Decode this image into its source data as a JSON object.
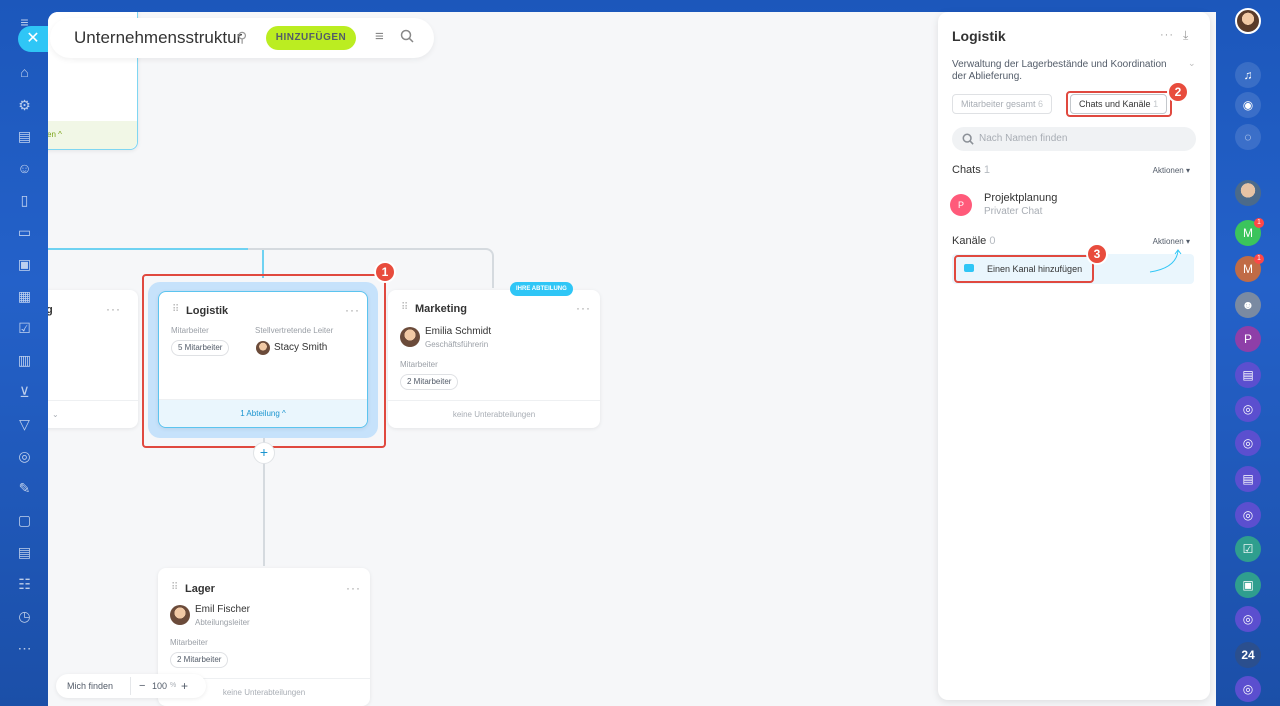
{
  "header": {
    "title": "Unternehmensstruktur",
    "add_button": "HINZUFÜGEN"
  },
  "cards": {
    "left_partial": {
      "footer": "en",
      "title_partial": "g"
    },
    "logistik": {
      "title": "Logistik",
      "employees_label": "Mitarbeiter",
      "employees_count": "5 Mitarbeiter",
      "deputy_label": "Stellvertretende Leiter",
      "deputy_name": "Stacy Smith",
      "footer": "1 Abteilung"
    },
    "marketing": {
      "badge": "IHRE ABTEILUNG",
      "title": "Marketing",
      "head_name": "Emilia Schmidt",
      "head_role": "Geschäftsführerin",
      "employees_label": "Mitarbeiter",
      "employees_count": "2 Mitarbeiter",
      "footer": "keine Unterabteilungen"
    },
    "lager": {
      "title": "Lager",
      "head_name": "Emil Fischer",
      "head_role": "Abteilungsleiter",
      "employees_label": "Mitarbeiter",
      "employees_count": "2 Mitarbeiter",
      "footer": "keine Unterabteilungen"
    }
  },
  "bottom_bar": {
    "find_me": "Mich finden",
    "zoom": "100",
    "zoom_unit": "%"
  },
  "panel": {
    "title": "Logistik",
    "description": "Verwaltung der Lagerbestände und Koordination der Ablieferung.",
    "tab_employees": "Mitarbeiter gesamt",
    "tab_employees_count": "6",
    "tab_chats": "Chats und Kanäle",
    "tab_chats_count": "1",
    "search_placeholder": "Nach Namen finden",
    "chats_title": "Chats",
    "chats_count": "1",
    "actions": "Aktionen",
    "chat_item_name": "Projektplanung",
    "chat_item_type": "Privater Chat",
    "chat_item_initial": "P",
    "channels_title": "Kanäle",
    "channels_count": "0",
    "add_channel": "Einen Kanal hinzufügen"
  },
  "annotations": {
    "one": "1",
    "two": "2",
    "three": "3"
  },
  "right_rail": {
    "badge_one": "1",
    "badge_two": "1",
    "initial_m": "M",
    "initial_m2": "M",
    "initial_p": "P",
    "app_24": "24"
  },
  "colors": {
    "accent": "#2fc6f6",
    "add_button": "#bbed21",
    "highlight": "#e0493f",
    "panel_link": "#2067b0"
  }
}
